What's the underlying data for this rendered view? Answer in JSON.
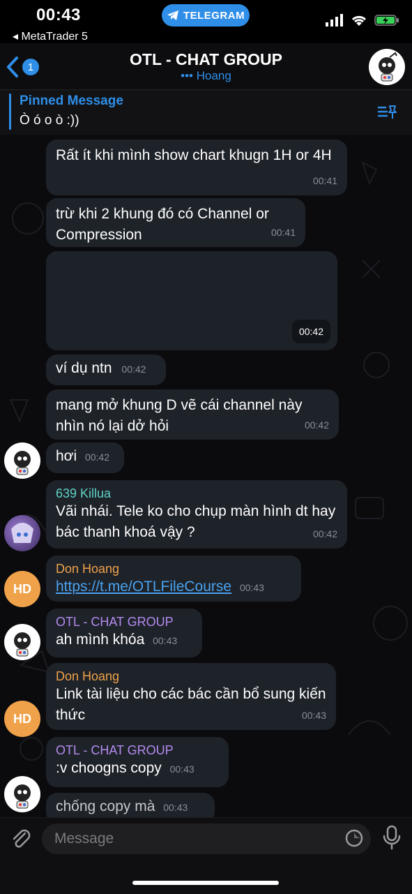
{
  "status_bar": {
    "time": "00:43",
    "back_app": "◂ MetaTrader 5",
    "pill_label": "TELEGRAM"
  },
  "header": {
    "back_badge": "1",
    "title": "OTL - CHAT GROUP",
    "subtitle": "••• Hoang"
  },
  "pinned": {
    "label": "Pinned Message",
    "text": "Ò ó o ò :))"
  },
  "messages": [
    {
      "text": "Rất ít khi mình show chart khugn 1H or 4H",
      "time": "00:41"
    },
    {
      "text": "trừ khi 2 khung đó có Channel or Compression",
      "time": "00:41"
    },
    {
      "time": "00:42"
    },
    {
      "text": "ví dụ ntn",
      "time": "00:42"
    },
    {
      "text": "mang mở khung D vẽ cái channel này nhìn nó lại dở hỏi",
      "time": "00:42"
    },
    {
      "text": "hơi",
      "time": "00:42"
    },
    {
      "sender": "639 Killua",
      "sender_color": "#5fd3c8",
      "text": "Vãi nhái. Tele ko cho chụp màn hình dt hay bác thanh khoá vậy ?",
      "time": "00:42"
    },
    {
      "sender": "Don Hoang",
      "sender_color": "#f0a24a",
      "text": "https://t.me/OTLFileCourse",
      "time": "00:43"
    },
    {
      "sender": "OTL - CHAT GROUP",
      "sender_color": "#b48cf0",
      "text": "ah mình khóa",
      "time": "00:43"
    },
    {
      "sender": "Don Hoang",
      "sender_color": "#f0a24a",
      "text": "Link tài liệu cho các bác cần bổ sung kiến thức",
      "time": "00:43"
    },
    {
      "sender": "OTL - CHAT GROUP",
      "sender_color": "#b48cf0",
      "text": ":v  choogns copy",
      "time": "00:43"
    },
    {
      "text": "chống copy mà",
      "time": "00:43"
    }
  ],
  "avatars": {
    "hd_initials": "HD"
  },
  "input": {
    "placeholder": "Message"
  },
  "colors": {
    "accent": "#2f8ee8",
    "bubble": "#1e2229",
    "link": "#4aa3f0"
  }
}
